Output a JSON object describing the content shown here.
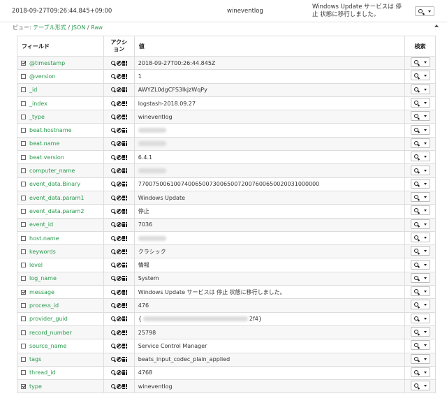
{
  "summary": {
    "timestamp": "2018-09-27T09:26:44.845+09:00",
    "type": "wineventlog",
    "message": "Windows Update サービスは 停止 状態に移行しました。"
  },
  "views": {
    "prefix": "ビュー: ",
    "table": "テーブル形式",
    "json": "JSON",
    "raw": "Raw",
    "sep": " / "
  },
  "table": {
    "headers": {
      "field": "フィールド",
      "action": "アクション",
      "value": "値",
      "search": "検索"
    },
    "rows": [
      {
        "field": "@timestamp",
        "value": "2018-09-27T00:26:44.845Z",
        "checked": true,
        "redacted": false
      },
      {
        "field": "@version",
        "value": "1",
        "checked": false,
        "redacted": false
      },
      {
        "field": "_id",
        "value": "AWYZL0dgCFS3lkjzWqPy",
        "checked": false,
        "redacted": false
      },
      {
        "field": "_index",
        "value": "logstash-2018.09.27",
        "checked": false,
        "redacted": false
      },
      {
        "field": "_type",
        "value": "wineventlog",
        "checked": false,
        "redacted": false
      },
      {
        "field": "beat.hostname",
        "value": "",
        "checked": false,
        "redacted": true
      },
      {
        "field": "beat.name",
        "value": "",
        "checked": false,
        "redacted": true
      },
      {
        "field": "beat.version",
        "value": "6.4.1",
        "checked": false,
        "redacted": false
      },
      {
        "field": "computer_name",
        "value": "",
        "checked": false,
        "redacted": true
      },
      {
        "field": "event_data.Binary",
        "value": "770075006100740065007300650072007600650020031000000",
        "checked": false,
        "redacted": false
      },
      {
        "field": "event_data.param1",
        "value": "Windows Update",
        "checked": false,
        "redacted": false
      },
      {
        "field": "event_data.param2",
        "value": "停止",
        "checked": false,
        "redacted": false
      },
      {
        "field": "event_id",
        "value": "7036",
        "checked": false,
        "redacted": false
      },
      {
        "field": "host.name",
        "value": "",
        "checked": false,
        "redacted": true
      },
      {
        "field": "keywords",
        "value": "クラシック",
        "checked": false,
        "redacted": false
      },
      {
        "field": "level",
        "value": "情報",
        "checked": false,
        "redacted": false
      },
      {
        "field": "log_name",
        "value": "System",
        "checked": false,
        "redacted": false
      },
      {
        "field": "message",
        "value": "Windows Update サービスは 停止 状態に移行しました。",
        "checked": true,
        "redacted": false
      },
      {
        "field": "process_id",
        "value": "476",
        "checked": false,
        "redacted": false
      },
      {
        "field": "provider_guid",
        "value": "",
        "value_prefix": "{",
        "value_suffix": "2f4}",
        "checked": false,
        "redacted": true
      },
      {
        "field": "record_number",
        "value": "25798",
        "checked": false,
        "redacted": false
      },
      {
        "field": "source_name",
        "value": "Service Control Manager",
        "checked": false,
        "redacted": false
      },
      {
        "field": "tags",
        "value": "beats_input_codec_plain_applied",
        "checked": false,
        "redacted": false
      },
      {
        "field": "thread_id",
        "value": "4768",
        "checked": false,
        "redacted": false
      },
      {
        "field": "type",
        "value": "wineventlog",
        "checked": true,
        "redacted": false
      }
    ]
  },
  "colors": {
    "link_green": "#2a9b4e",
    "row_stripe": "#f7f7f7",
    "border": "#dcdcdc"
  },
  "icons": {
    "summary_search": "search-icon",
    "summary_dropdown": "caret-down-icon",
    "collapse": "chevron-up-icon",
    "row_actions": [
      "filter-for-value-icon",
      "filter-out-value-icon",
      "toggle-column-icon"
    ]
  }
}
